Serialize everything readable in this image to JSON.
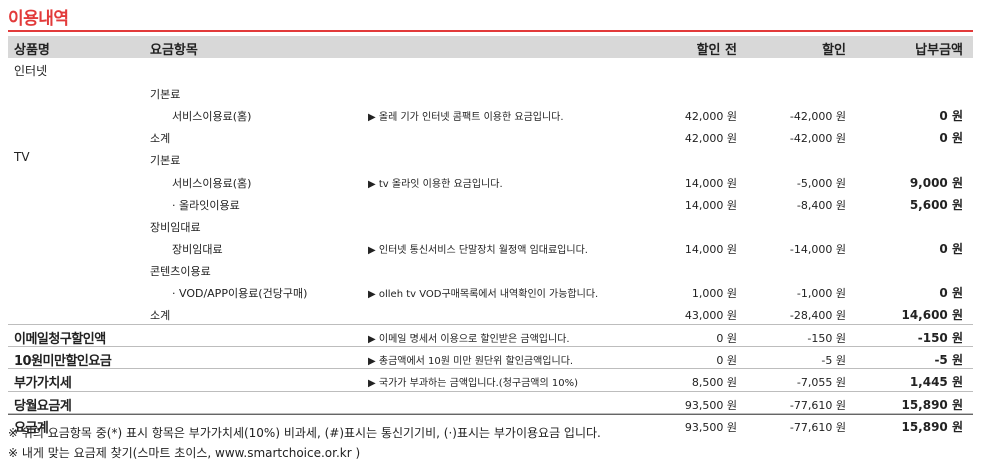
{
  "title": "이용내역",
  "header": {
    "product": "상품명",
    "item": "요금항목",
    "before": "할인 전",
    "discount": "할인",
    "pay": "납부금액"
  },
  "rows": [
    {
      "name": "인터넷",
      "big": false,
      "sep": false,
      "item": "",
      "l2": false,
      "desc": "",
      "before": "",
      "disc": "",
      "pay": ""
    },
    {
      "name": "",
      "big": false,
      "sep": false,
      "item": "기본료",
      "l2": false,
      "desc": "",
      "before": "",
      "disc": "",
      "pay": ""
    },
    {
      "name": "",
      "big": false,
      "sep": false,
      "item": "서비스이용료(홈)",
      "l2": true,
      "desc": "▶ 올레 기가 인터넷 콤팩트 이용한 요금입니다.",
      "before": "42,000 원",
      "disc": "-42,000 원",
      "pay": "0 원"
    },
    {
      "name": "",
      "big": false,
      "sep": false,
      "item": "소계",
      "l2": false,
      "desc": "",
      "before": "42,000 원",
      "disc": "-42,000 원",
      "pay": "0 원"
    },
    {
      "name": "TV",
      "big": false,
      "sep": false,
      "item": "기본료",
      "l2": false,
      "desc": "",
      "before": "",
      "disc": "",
      "pay": ""
    },
    {
      "name": "",
      "big": false,
      "sep": false,
      "item": "서비스이용료(홈)",
      "l2": true,
      "desc": "▶ tv 올라잇 이용한 요금입니다.",
      "before": "14,000 원",
      "disc": "-5,000 원",
      "pay": "9,000 원"
    },
    {
      "name": "",
      "big": false,
      "sep": false,
      "item": "· 올라잇이용료",
      "l2": true,
      "desc": "",
      "before": "14,000 원",
      "disc": "-8,400 원",
      "pay": "5,600 원"
    },
    {
      "name": "",
      "big": false,
      "sep": false,
      "item": "장비임대료",
      "l2": false,
      "desc": "",
      "before": "",
      "disc": "",
      "pay": ""
    },
    {
      "name": "",
      "big": false,
      "sep": false,
      "item": "장비임대료",
      "l2": true,
      "desc": "▶ 인터넷 통신서비스 단말장치 월정액 임대료입니다.",
      "before": "14,000 원",
      "disc": "-14,000 원",
      "pay": "0 원"
    },
    {
      "name": "",
      "big": false,
      "sep": false,
      "item": "콘텐츠이용료",
      "l2": false,
      "desc": "",
      "before": "",
      "disc": "",
      "pay": ""
    },
    {
      "name": "",
      "big": false,
      "sep": false,
      "item": "· VOD/APP이용료(건당구매)",
      "l2": true,
      "desc": "▶ olleh tv VOD구매목록에서 내역확인이 가능합니다.",
      "before": "1,000 원",
      "disc": "-1,000 원",
      "pay": "0 원"
    },
    {
      "name": "",
      "big": false,
      "sep": false,
      "item": "소계",
      "l2": false,
      "desc": "",
      "before": "43,000 원",
      "disc": "-28,400 원",
      "pay": "14,600 원"
    },
    {
      "name": "이메일청구할인액",
      "big": true,
      "sep": true,
      "item": "",
      "l2": false,
      "desc": "▶ 이메일 명세서 이용으로 할인받은 금액입니다.",
      "before": "0 원",
      "disc": "-150 원",
      "pay": "-150 원"
    },
    {
      "name": "10원미만할인요금",
      "big": true,
      "sep": true,
      "item": "",
      "l2": false,
      "desc": "▶ 총금액에서 10원 미만 원단위 할인금액입니다.",
      "before": "0 원",
      "disc": "-5 원",
      "pay": "-5 원"
    },
    {
      "name": "부가가치세",
      "big": true,
      "sep": true,
      "item": "",
      "l2": false,
      "desc": "▶ 국가가 부과하는 금액입니다.(청구금액의 10%)",
      "before": "8,500 원",
      "disc": "-7,055 원",
      "pay": "1,445 원"
    },
    {
      "name": "당월요금계",
      "big": true,
      "sep": true,
      "item": "",
      "l2": false,
      "desc": "",
      "before": "93,500 원",
      "disc": "-77,610 원",
      "pay": "15,890 원"
    },
    {
      "name": "요금계",
      "big": true,
      "sep": true,
      "item": "",
      "l2": false,
      "desc": "",
      "before": "93,500 원",
      "disc": "-77,610 원",
      "pay": "15,890 원"
    }
  ],
  "notes": [
    "※ 위의 요금항목 중(*) 표시 항목은 부가가치세(10%) 비과세, (#)표시는 통신기기비, (·)표시는 부가이용요금 입니다.",
    "※ 내게 맞는 요금제 찾기(스마트 초이스, www.smartchoice.or.kr )"
  ]
}
